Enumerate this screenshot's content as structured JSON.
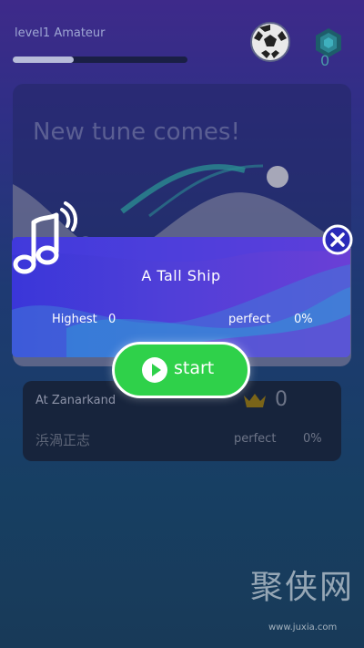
{
  "header": {
    "level_label": "level1 Amateur",
    "gem_count": "0",
    "xp_progress": 0.35
  },
  "background_card": {
    "headline": "New tune comes!"
  },
  "song_popup": {
    "title": "A Tall Ship",
    "highest_label": "Highest",
    "highest_value": "0",
    "perfect_label": "perfect",
    "perfect_value": "0%",
    "start_label": "start"
  },
  "list_item": {
    "title": "At Zanarkand",
    "crown_count": "0",
    "subtitle": "浜渦正志",
    "perfect_label": "perfect",
    "perfect_value": "0%"
  },
  "watermark": {
    "text": "聚侠网",
    "url": "www.juxia.com"
  },
  "colors": {
    "start_green": "#2fd14a",
    "panel_blue": "#3a36d9",
    "panel_purple": "#6a3fd6"
  },
  "icons": [
    "soccer-ball-icon",
    "gem-icon",
    "music-note-icon",
    "close-icon",
    "play-icon",
    "crown-icon"
  ]
}
